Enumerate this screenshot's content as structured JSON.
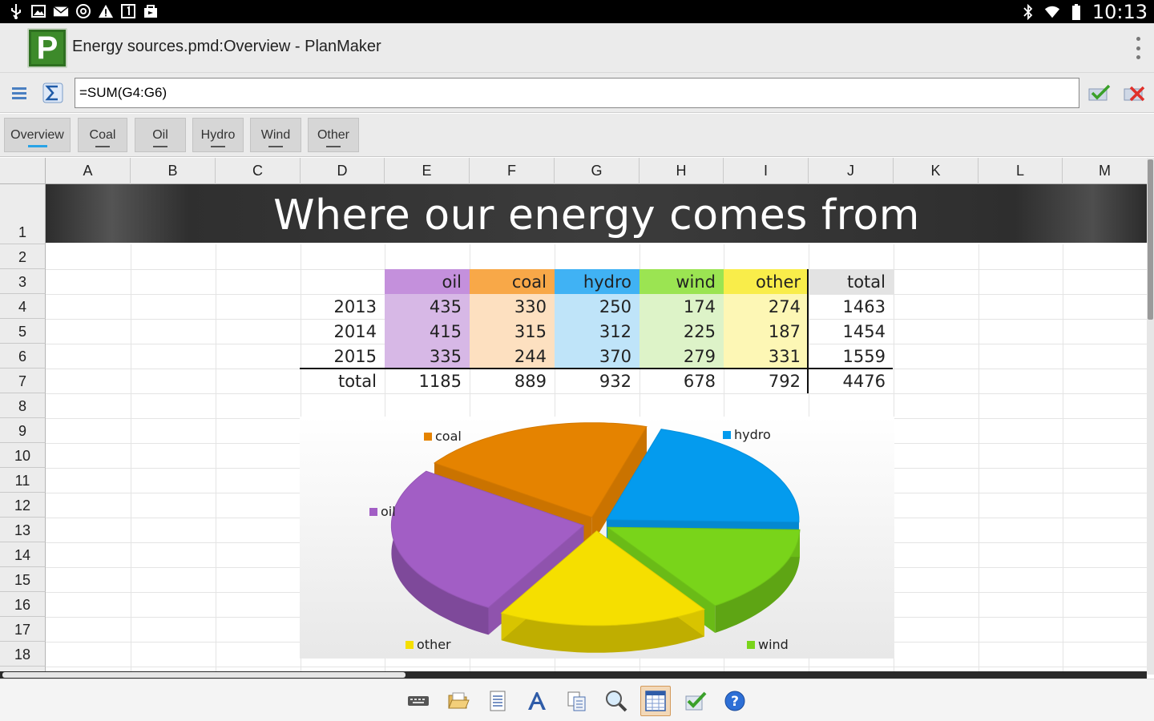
{
  "status_bar": {
    "time": "10:13"
  },
  "title_bar": {
    "logo_letter": "P",
    "title": "Energy sources.pmd:Overview - PlanMaker"
  },
  "formula_bar": {
    "value": "=SUM(G4:G6)"
  },
  "sheet_tabs": [
    {
      "label": "Overview",
      "active": true
    },
    {
      "label": "Coal"
    },
    {
      "label": "Oil"
    },
    {
      "label": "Hydro"
    },
    {
      "label": "Wind"
    },
    {
      "label": "Other"
    }
  ],
  "columns": [
    "A",
    "B",
    "C",
    "D",
    "E",
    "F",
    "G",
    "H",
    "I",
    "J",
    "K",
    "L",
    "M"
  ],
  "rows": [
    "1",
    "2",
    "3",
    "4",
    "5",
    "6",
    "7",
    "8",
    "9",
    "10",
    "11",
    "12",
    "13",
    "14",
    "15",
    "16",
    "17",
    "18"
  ],
  "sheet": {
    "banner": "Where our energy comes from",
    "headers": [
      "oil",
      "coal",
      "hydro",
      "wind",
      "other",
      "total"
    ],
    "years": [
      "2013",
      "2014",
      "2015"
    ],
    "values": [
      [
        "435",
        "330",
        "250",
        "174",
        "274",
        "1463"
      ],
      [
        "415",
        "315",
        "312",
        "225",
        "187",
        "1454"
      ],
      [
        "335",
        "244",
        "370",
        "279",
        "331",
        "1559"
      ]
    ],
    "total_label": "total",
    "totals": [
      "1185",
      "889",
      "932",
      "678",
      "792",
      "4476"
    ]
  },
  "colors": {
    "oil": "#a25ec5",
    "coal": "#e58300",
    "hydro": "#049bee",
    "wind": "#79d41a",
    "other": "#f5df00",
    "oil_header": "#c490dc",
    "coal_header": "#f8a848",
    "hydro_header": "#40b2f4",
    "wind_header": "#9be452",
    "other_header": "#f9ed4a",
    "oil_cell": "#d7b8e6",
    "coal_cell": "#fde0c0",
    "hydro_cell": "#bfe4f9",
    "wind_cell": "#ddf3c8",
    "other_cell": "#fdf7b5",
    "total_header": "#e3e3e3"
  },
  "chart_data": {
    "type": "pie",
    "categories": [
      "oil",
      "coal",
      "hydro",
      "wind",
      "other"
    ],
    "values": [
      1185,
      889,
      932,
      678,
      792
    ],
    "legend": [
      "coal",
      "hydro",
      "oil",
      "other",
      "wind"
    ],
    "three_d": true,
    "exploded": true
  },
  "bottom_toolbar": [
    "keyboard-icon",
    "folder-open-icon",
    "document-icon",
    "font-icon",
    "copy-paste-icon",
    "zoom-icon",
    "table-icon",
    "checkmark-icon",
    "help-icon"
  ]
}
